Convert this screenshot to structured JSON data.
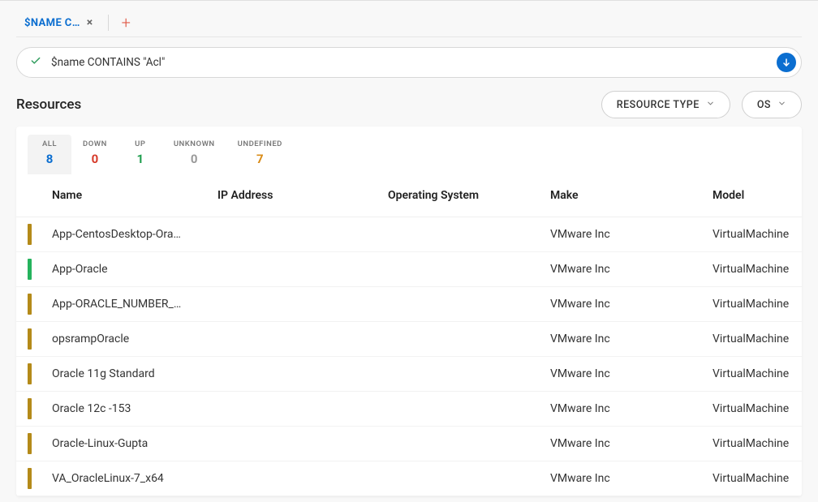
{
  "tabs": {
    "active_label": "$NAME C…"
  },
  "search": {
    "query": "$name CONTAINS \"Acl\""
  },
  "section": {
    "title": "Resources"
  },
  "filters": {
    "resource_type_label": "RESOURCE TYPE",
    "os_label": "OS"
  },
  "status_tabs": [
    {
      "label": "ALL",
      "count": "8",
      "color": "blue",
      "active": true
    },
    {
      "label": "DOWN",
      "count": "0",
      "color": "red",
      "active": false
    },
    {
      "label": "UP",
      "count": "1",
      "color": "green",
      "active": false
    },
    {
      "label": "UNKNOWN",
      "count": "0",
      "color": "gray",
      "active": false
    },
    {
      "label": "UNDEFINED",
      "count": "7",
      "color": "orange",
      "active": false
    }
  ],
  "table": {
    "headers": {
      "name": "Name",
      "ip": "IP Address",
      "os": "Operating System",
      "make": "Make",
      "model": "Model"
    },
    "rows": [
      {
        "status": "unknown",
        "name": "App-CentosDesktop-Ora…",
        "ip": "",
        "os": "",
        "make": "VMware Inc",
        "model": "VirtualMachine"
      },
      {
        "status": "up",
        "name": "App-Oracle",
        "ip": "",
        "os": "",
        "make": "VMware Inc",
        "model": "VirtualMachine"
      },
      {
        "status": "unknown",
        "name": "App-ORACLE_NUMBER_…",
        "ip": "",
        "os": "",
        "make": "VMware Inc",
        "model": "VirtualMachine"
      },
      {
        "status": "unknown",
        "name": "opsrampOracle",
        "ip": "",
        "os": "",
        "make": "VMware Inc",
        "model": "VirtualMachine"
      },
      {
        "status": "unknown",
        "name": "Oracle 11g Standard",
        "ip": "",
        "os": "",
        "make": "VMware Inc",
        "model": "VirtualMachine"
      },
      {
        "status": "unknown",
        "name": "Oracle 12c -153",
        "ip": "",
        "os": "",
        "make": "VMware Inc",
        "model": "VirtualMachine"
      },
      {
        "status": "unknown",
        "name": "Oracle-Linux-Gupta",
        "ip": "",
        "os": "",
        "make": "VMware Inc",
        "model": "VirtualMachine"
      },
      {
        "status": "unknown",
        "name": "VA_OracleLinux-7_x64",
        "ip": "",
        "os": "",
        "make": "VMware Inc",
        "model": "VirtualMachine"
      }
    ]
  }
}
